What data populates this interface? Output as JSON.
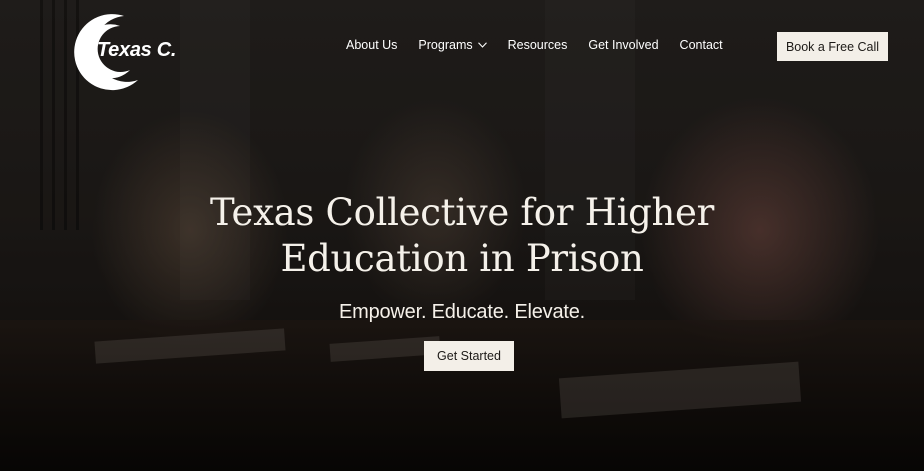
{
  "brand": {
    "logo_text": "Texas C."
  },
  "nav": {
    "items": [
      {
        "label": "About Us"
      },
      {
        "label": "Programs"
      },
      {
        "label": "Resources"
      },
      {
        "label": "Get Involved"
      },
      {
        "label": "Contact"
      }
    ],
    "programs_icon": "chevron-down-icon",
    "cta_label": "Book a Free Call"
  },
  "hero": {
    "headline_line1": "Texas Collective for Higher",
    "headline_line2": "Education in Prison",
    "tagline": "Empower. Educate. Elevate.",
    "cta_label": "Get Started"
  },
  "colors": {
    "button_bg": "#f3efe8",
    "button_text": "#1d1a17",
    "text": "#f5f1ea"
  }
}
